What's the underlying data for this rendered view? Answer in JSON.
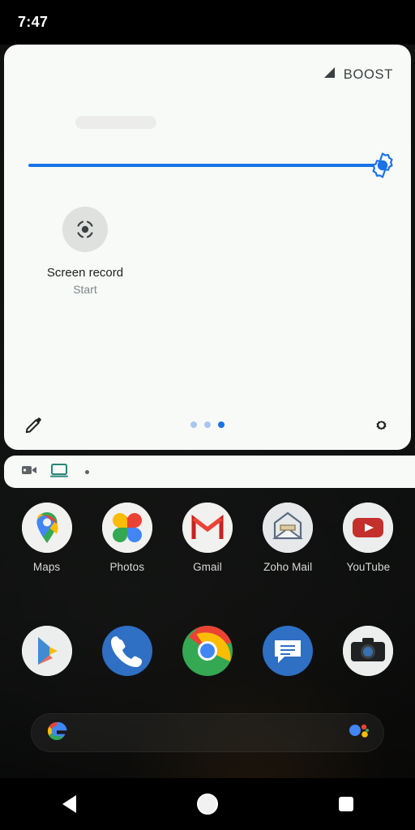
{
  "statusbar": {
    "clock": "7:47"
  },
  "quick_settings": {
    "boost": {
      "label": "BOOST",
      "icon": "signal-triangle-icon"
    },
    "brightness": {
      "name": "brightness-slider",
      "value_percent": 100,
      "track_color": "#1a73e8",
      "thumb_icon": "brightness-sun-icon"
    },
    "tiles": [
      {
        "name": "screen-record",
        "icon": "screen-record-icon",
        "label": "Screen record",
        "state": "Start",
        "active": false
      }
    ],
    "footer": {
      "edit_label": "Edit",
      "edit_icon": "pencil-icon",
      "settings_label": "Settings",
      "settings_icon": "gear-icon",
      "pager": {
        "total": 3,
        "active_index": 3
      }
    },
    "panel_color": "#f7faf6"
  },
  "notification_strip": {
    "icons": [
      "video-camera-icon",
      "cast-screen-icon"
    ],
    "overflow_dot": true,
    "cast_icon_color": "#2a8577"
  },
  "home": {
    "app_rows": [
      {
        "name": "app-row-1",
        "apps": [
          {
            "label": "Maps",
            "icon": "google-maps-icon"
          },
          {
            "label": "Photos",
            "icon": "google-photos-icon"
          },
          {
            "label": "Gmail",
            "icon": "gmail-icon"
          },
          {
            "label": "Zoho Mail",
            "icon": "zoho-mail-icon"
          },
          {
            "label": "YouTube",
            "icon": "youtube-icon"
          }
        ]
      },
      {
        "name": "app-row-2",
        "apps": [
          {
            "label": "",
            "icon": "play-store-icon"
          },
          {
            "label": "",
            "icon": "phone-icon"
          },
          {
            "label": "",
            "icon": "chrome-icon"
          },
          {
            "label": "",
            "icon": "messages-icon"
          },
          {
            "label": "",
            "icon": "camera-icon"
          }
        ]
      }
    ],
    "search": {
      "placeholder": "",
      "value": "",
      "left_icon": "google-g-icon",
      "right_icon": "google-assistant-icon"
    }
  },
  "navbar": {
    "back_label": "Back",
    "home_label": "Home",
    "recents_label": "Recents"
  }
}
